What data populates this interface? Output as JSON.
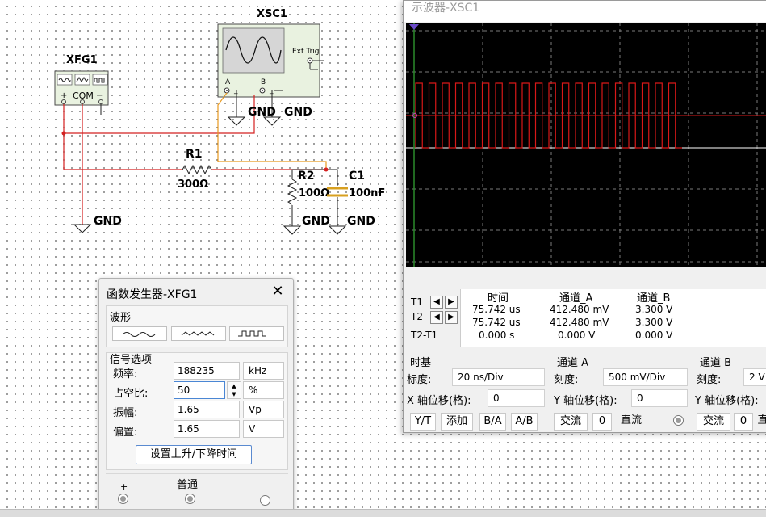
{
  "circuit": {
    "xfg_label": "XFG1",
    "xfg_com": "COM",
    "xsc_label": "XSC1",
    "xsc_ext_trig": "Ext Trig",
    "xsc_a": "A",
    "xsc_b": "B",
    "gnd_a": "GND",
    "gnd_b": "GND",
    "gnd_fg": "GND",
    "gnd_r2": "GND",
    "gnd_c1": "GND",
    "r1_name": "R1",
    "r1_value": "300Ω",
    "r2_name": "R2",
    "r2_value": "100Ω",
    "c1_name": "C1",
    "c1_value": "100nF",
    "plus": "+",
    "minus": "−"
  },
  "scope": {
    "title": "示波器-XSC1",
    "readout": {
      "t1": "T1",
      "t2": "T2",
      "t2t1": "T2-T1",
      "col_time": "时间",
      "col_a": "通道_A",
      "col_b": "通道_B",
      "row1": {
        "time": "75.742 us",
        "a": "412.480 mV",
        "b": "3.300 V"
      },
      "row2": {
        "time": "75.742 us",
        "a": "412.480 mV",
        "b": "3.300 V"
      },
      "row3": {
        "time": "0.000 s",
        "a": "0.000 V",
        "b": "0.000 V"
      }
    },
    "timebase": {
      "title": "时基",
      "scale_label": "标度:",
      "scale_value": "20 ns/Div",
      "xpos_label": "X 轴位移(格):",
      "xpos_value": "0",
      "btn_yt": "Y/T",
      "btn_add": "添加",
      "btn_ba": "B/A",
      "btn_ab": "A/B"
    },
    "channel_a": {
      "title": "通道 A",
      "scale_label": "刻度:",
      "scale_value": "500 mV/Div",
      "ypos_label": "Y 轴位移(格):",
      "ypos_value": "0",
      "btn_ac": "交流",
      "btn_zero": "0",
      "btn_dc": "直流"
    },
    "channel_b": {
      "title": "通道 B",
      "scale_label": "刻度:",
      "scale_value": "2 V",
      "ypos_label": "Y 轴位移(格):",
      "btn_ac": "交流",
      "btn_zero": "0",
      "btn_dc": "直"
    },
    "colors": {
      "trace_a": "#d81818",
      "grid": "#7a7a7a",
      "screen": "#000000",
      "axis": "#ffffff",
      "marker": "#2a8a2a"
    }
  },
  "fgen": {
    "title": "函数发生器-XFG1",
    "close": "✕",
    "waveform_title": "波形",
    "signal_title": "信号选项",
    "freq_label": "频率:",
    "freq_value": "188235",
    "freq_unit": "kHz",
    "duty_label": "占空比:",
    "duty_value": "50",
    "duty_unit": "%",
    "amp_label": "振幅:",
    "amp_value": "1.65",
    "amp_unit": "Vp",
    "offset_label": "偏置:",
    "offset_value": "1.65",
    "offset_unit": "V",
    "rise_fall_button": "设置上升/下降时间",
    "terminal_plus": "+",
    "terminal_common": "普通",
    "terminal_minus": "_"
  }
}
